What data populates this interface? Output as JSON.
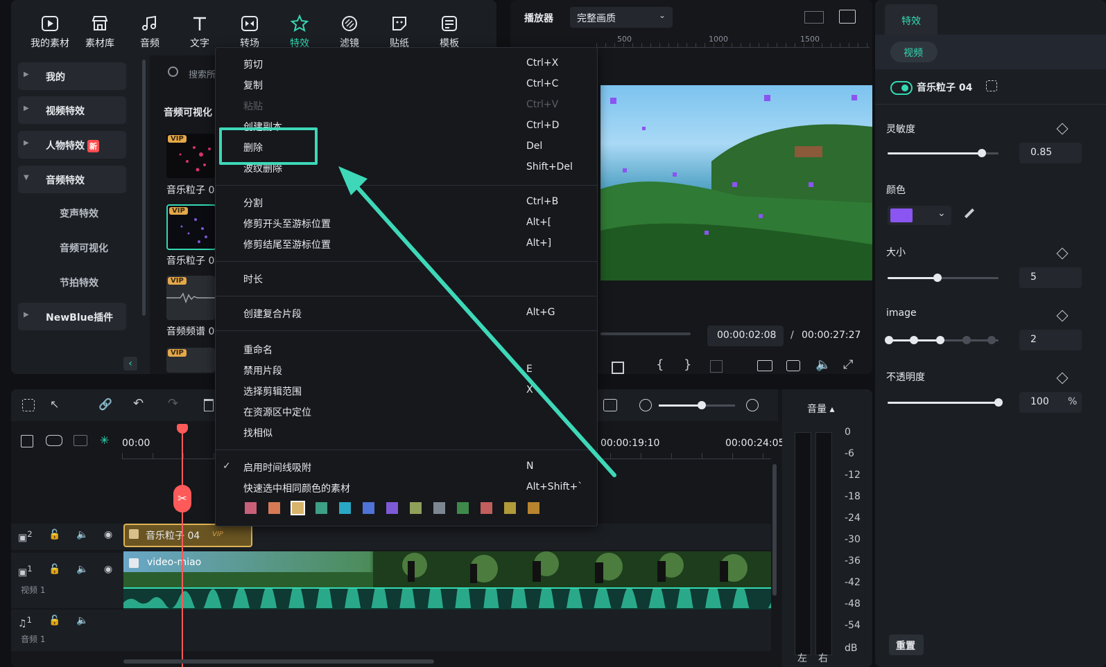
{
  "toolbar": {
    "items": [
      "我的素材",
      "素材库",
      "音频",
      "文字",
      "转场",
      "特效",
      "滤镜",
      "贴纸",
      "模板"
    ]
  },
  "sidebar": {
    "search_placeholder": "搜索所",
    "categories": [
      "我的",
      "视频特效",
      "人物特效",
      "音频特效",
      "NewBlue插件"
    ],
    "new_badge": "新",
    "subcategories": [
      "变声特效",
      "音频可视化",
      "节拍特效"
    ],
    "section_title": "音频可视化",
    "thumbs": [
      "音乐粒子 0",
      "音乐粒子 0",
      "音频频谱 0",
      ""
    ],
    "vip": "VIP"
  },
  "player": {
    "label": "播放器",
    "quality": "完整画质",
    "ruler_marks": [
      "500",
      "1000",
      "1500"
    ],
    "current_time": "00:00:02:08",
    "divider": "/",
    "total_time": "00:00:27:27"
  },
  "context_menu": {
    "items": [
      {
        "label": "剪切",
        "shortcut": "Ctrl+X",
        "disabled": false
      },
      {
        "label": "复制",
        "shortcut": "Ctrl+C",
        "disabled": false
      },
      {
        "label": "粘贴",
        "shortcut": "Ctrl+V",
        "disabled": true
      },
      {
        "label": "创建副本",
        "shortcut": "Ctrl+D",
        "disabled": false
      },
      {
        "label": "删除",
        "shortcut": "Del",
        "disabled": false
      },
      {
        "label": "波纹删除",
        "shortcut": "Shift+Del",
        "disabled": false
      },
      {
        "label": "分割",
        "shortcut": "Ctrl+B",
        "disabled": false
      },
      {
        "label": "修剪开头至游标位置",
        "shortcut": "Alt+[",
        "disabled": false
      },
      {
        "label": "修剪结尾至游标位置",
        "shortcut": "Alt+]",
        "disabled": false
      },
      {
        "label": "时长",
        "shortcut": "",
        "disabled": false
      },
      {
        "label": "创建复合片段",
        "shortcut": "Alt+G",
        "disabled": false
      },
      {
        "label": "重命名",
        "shortcut": "",
        "disabled": false
      },
      {
        "label": "禁用片段",
        "shortcut": "E",
        "disabled": false
      },
      {
        "label": "选择剪辑范围",
        "shortcut": "X",
        "disabled": false
      },
      {
        "label": "在资源区中定位",
        "shortcut": "",
        "disabled": false
      },
      {
        "label": "找相似",
        "shortcut": "",
        "disabled": false
      },
      {
        "label": "启用时间线吸附",
        "shortcut": "N",
        "disabled": false
      },
      {
        "label": "快速选中相同颜色的素材",
        "shortcut": "Alt+Shift+`",
        "disabled": false
      }
    ],
    "checkmark": "✓",
    "colors": [
      "#c8607a",
      "#d67a56",
      "#d8b36a",
      "#3d9f86",
      "#2aa7c4",
      "#4f73d6",
      "#7d5ad6",
      "#8fa05a",
      "#7d8791",
      "#3f8a4a",
      "#c25e5e",
      "#b09a3a",
      "#b8842e"
    ]
  },
  "timeline": {
    "ruler_labels": [
      "00:00",
      "00:00:19:10",
      "00:00:24:05"
    ],
    "tracks": [
      {
        "num": "2",
        "label": ""
      },
      {
        "num": "1",
        "label": "视频 1"
      },
      {
        "num": "1",
        "label": "音频 1"
      }
    ],
    "effect_clip": "音乐粒子 04",
    "effect_clip_badge": "VIP",
    "video_clip": "video-miao",
    "volume_label": "音量",
    "db_scale": [
      "0",
      "-6",
      "-12",
      "-18",
      "-24",
      "-30",
      "-36",
      "-42",
      "-48",
      "-54",
      "dB"
    ],
    "left": "左",
    "right": "右"
  },
  "right_panel": {
    "tab": "特效",
    "subtab": "视频",
    "effect_name": "音乐粒子 04",
    "sensitivity": {
      "label": "灵敏度",
      "value": "0.85",
      "fraction": 0.85
    },
    "color": {
      "label": "颜色",
      "value": "#8a55f0"
    },
    "size": {
      "label": "大小",
      "value": "5",
      "fraction": 0.45
    },
    "image": {
      "label": "image",
      "value": "2"
    },
    "opacity": {
      "label": "不透明度",
      "value": "100",
      "unit": "%",
      "fraction": 1.0
    },
    "reset": "重置"
  },
  "colors": {
    "accent": "#33d9b2",
    "highlight": "#3ed8b8"
  }
}
